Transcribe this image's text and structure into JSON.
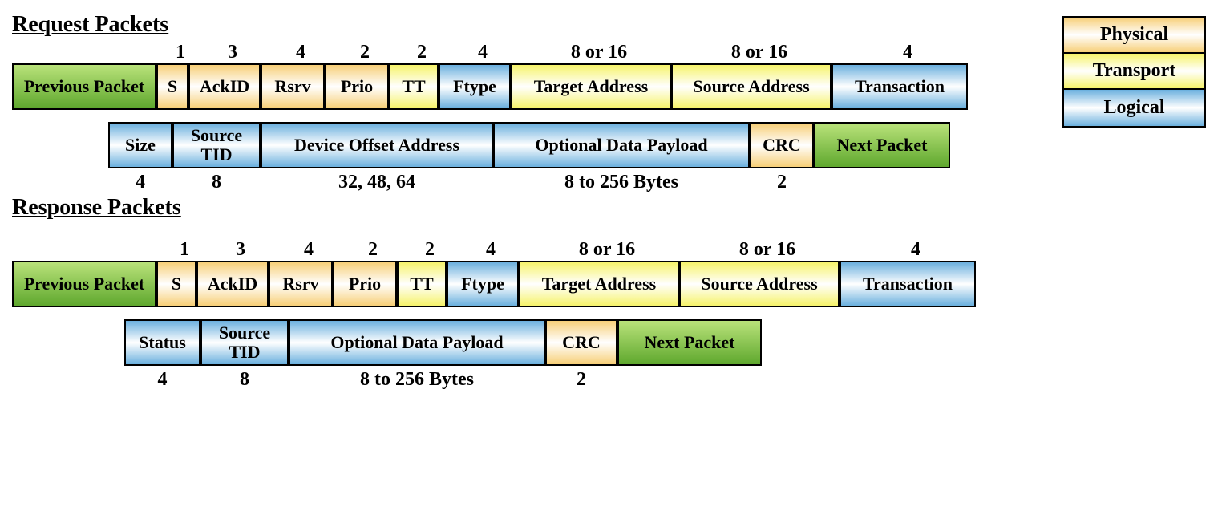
{
  "legend": {
    "physical": "Physical",
    "transport": "Transport",
    "logical": "Logical"
  },
  "request": {
    "title": "Request Packets",
    "row1_sizes": [
      "1",
      "3",
      "4",
      "2",
      "2",
      "4",
      "8 or 16",
      "8 or 16",
      "4"
    ],
    "row1_fields": {
      "prev": "Previous Packet",
      "s": "S",
      "ackid": "AckID",
      "rsrv": "Rsrv",
      "prio": "Prio",
      "tt": "TT",
      "ftype": "Ftype",
      "target": "Target Address",
      "source": "Source Address",
      "trans": "Transaction"
    },
    "row2_fields": {
      "size": "Size",
      "stid": "Source TID",
      "devoff": "Device Offset Address",
      "payload": "Optional Data Payload",
      "crc": "CRC",
      "next": "Next Packet"
    },
    "row2_sizes": [
      "4",
      "8",
      "32, 48, 64",
      "8 to 256 Bytes",
      "2"
    ]
  },
  "response": {
    "title": "Response Packets",
    "row1_sizes": [
      "1",
      "3",
      "4",
      "2",
      "2",
      "4",
      "8 or 16",
      "8 or 16",
      "4"
    ],
    "row1_fields": {
      "prev": "Previous Packet",
      "s": "S",
      "ackid": "AckID",
      "rsrv": "Rsrv",
      "prio": "Prio",
      "tt": "TT",
      "ftype": "Ftype",
      "target": "Target Address",
      "source": "Source Address",
      "trans": "Transaction"
    },
    "row2_fields": {
      "status": "Status",
      "stid": "Source TID",
      "payload": "Optional Data Payload",
      "crc": "CRC",
      "next": "Next Packet"
    },
    "row2_sizes": [
      "4",
      "8",
      "8 to 256 Bytes",
      "2"
    ]
  }
}
